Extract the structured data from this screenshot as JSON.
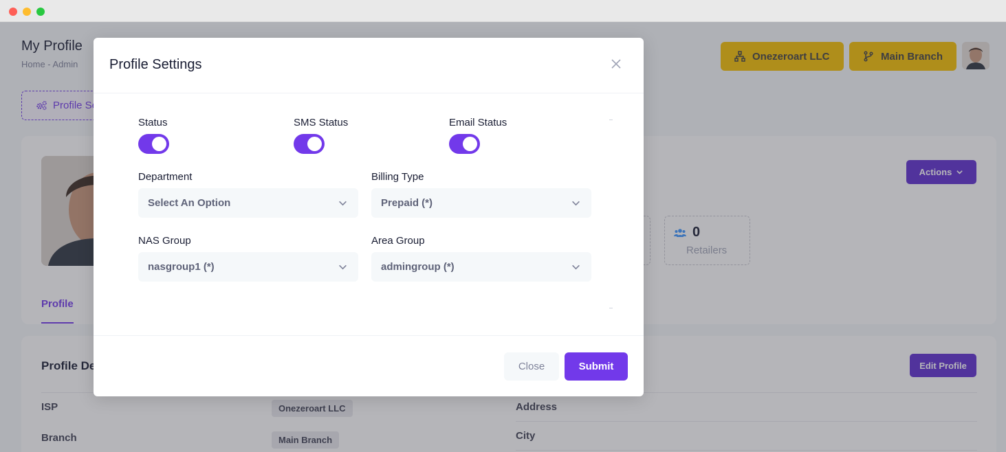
{
  "window": {
    "controls": [
      "close",
      "minimize",
      "zoom"
    ]
  },
  "header": {
    "title": "My Profile",
    "breadcrumb": "Home  -  Admin",
    "company_button": "Onezeroart LLC",
    "branch_button": "Main Branch"
  },
  "toolbar": {
    "profile_settings_tab": "Profile Se"
  },
  "overview": {
    "actions_label": "Actions",
    "stat": {
      "value": "0",
      "label": "Retailers"
    },
    "profile_tab": "Profile"
  },
  "details": {
    "title": "Profile De",
    "edit_label": "Edit Profile",
    "rows_left": [
      {
        "label": "ISP",
        "value": "Onezeroart LLC"
      },
      {
        "label": "Branch",
        "value": "Main Branch"
      }
    ],
    "rows_right": [
      {
        "label": "Address"
      },
      {
        "label": "City"
      }
    ]
  },
  "modal": {
    "title": "Profile Settings",
    "toggles": [
      {
        "label": "Status",
        "on": true
      },
      {
        "label": "SMS Status",
        "on": true
      },
      {
        "label": "Email Status",
        "on": true
      }
    ],
    "fields": {
      "department": {
        "label": "Department",
        "value": "Select An Option"
      },
      "billing_type": {
        "label": "Billing Type",
        "value": "Prepaid (*)"
      },
      "nas_group": {
        "label": "NAS Group",
        "value": "nasgroup1 (*)"
      },
      "area_group": {
        "label": "Area Group",
        "value": "admingroup (*)"
      }
    },
    "close_label": "Close",
    "submit_label": "Submit"
  },
  "colors": {
    "accent": "#7239ea",
    "yellow": "#f5c000",
    "actions": "#5e2ed0"
  }
}
